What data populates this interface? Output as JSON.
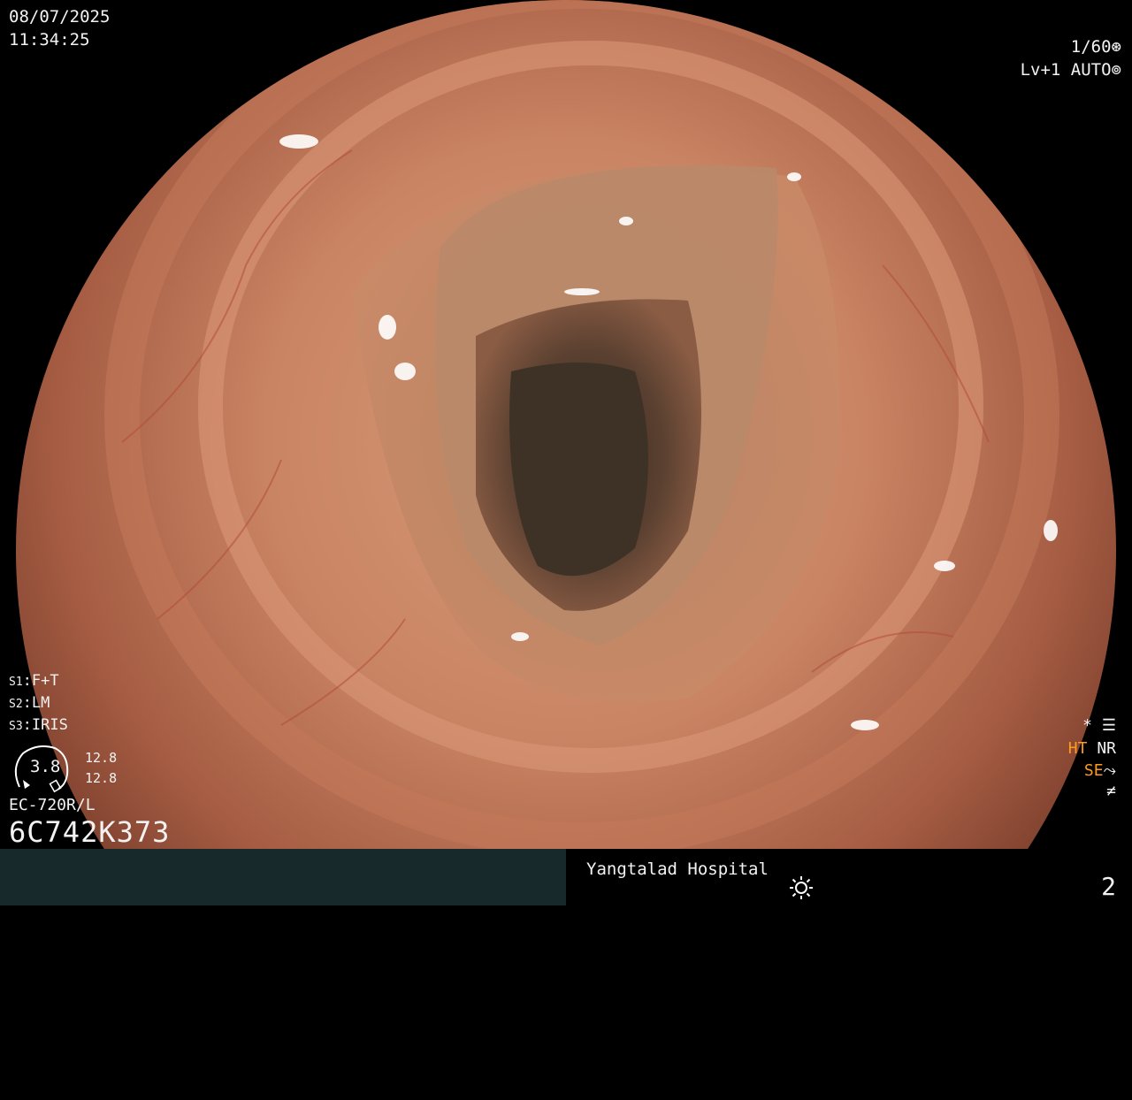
{
  "header": {
    "date": "08/07/2025",
    "time": "11:34:25"
  },
  "top_right": {
    "shutter": "1/60",
    "shutter_icon": "shutter-icon",
    "level": "Lv+1",
    "mode": "AUTO",
    "mode_icon": "iris-icon"
  },
  "settings": {
    "s1": {
      "tag": "S1",
      "value": "F+T"
    },
    "s2": {
      "tag": "S2",
      "value": "LM"
    },
    "s3": {
      "tag": "S3",
      "value": "IRIS"
    }
  },
  "gauge": {
    "value": "3.8",
    "upper": "12.8",
    "lower": "12.8"
  },
  "scope_info": {
    "model": "EC-720R/L",
    "serial": "6C742K373"
  },
  "bottom_right": {
    "star": "*",
    "ht": "HT",
    "nr": "NR",
    "se": "SE",
    "f_icon": "not-equal-icon"
  },
  "footer": {
    "hospital": "Yangtalad Hospital",
    "light_icon": "sun-icon",
    "page": "2"
  },
  "colors": {
    "accent_orange": "#ff9a1a",
    "footer_panel": "#18292b"
  }
}
